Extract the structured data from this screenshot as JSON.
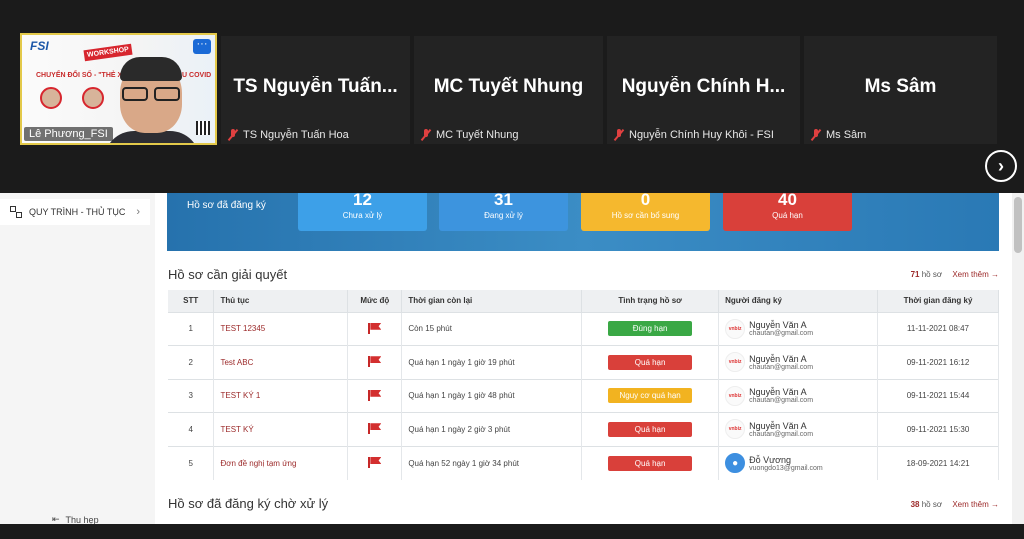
{
  "meeting": {
    "self_tile": {
      "name": "Lê Phương_FSI",
      "slide_logo": "FSI",
      "slide_badge": "WORKSHOP",
      "slide_title": "CHUYỂN ĐỔI SỐ - \"THẺ XANH",
      "slide_title_end": "ẤU COVID",
      "more_label": "···"
    },
    "participants": [
      {
        "display": "TS Nguyễn Tuấn...",
        "label": "TS Nguyễn Tuấn Hoa"
      },
      {
        "display": "MC Tuyết Nhung",
        "label": "MC Tuyết Nhung"
      },
      {
        "display": "Nguyễn Chính H...",
        "label": "Nguyễn Chính Huy Khôi - FSI"
      },
      {
        "display": "Ms Sâm",
        "label": "Ms Sâm"
      }
    ],
    "next_icon": "›"
  },
  "sidebar": {
    "item_label": "QUY TRÌNH - THỦ TỤC",
    "item_chevron": "›",
    "collapse_icon": "⇤",
    "collapse_label": "Thu hẹp"
  },
  "banner": {
    "label": "Hồ sơ đã đăng ký",
    "stats": [
      {
        "value": "12",
        "label": "Chưa xử lý",
        "color": "#3da0e8"
      },
      {
        "value": "31",
        "label": "Đang xử lý",
        "color": "#3d94de"
      },
      {
        "value": "0",
        "label": "Hồ sơ cần bổ sung",
        "color": "#f5b82e"
      },
      {
        "value": "40",
        "label": "Quá hạn",
        "color": "#d9403a"
      }
    ]
  },
  "section1": {
    "title": "Hồ sơ cần giải quyết",
    "count": "71",
    "count_suffix": " hồ sơ",
    "see_more": "Xem thêm →"
  },
  "table": {
    "headers": [
      "STT",
      "Thủ tục",
      "Mức độ",
      "Thời gian còn lại",
      "Tình trạng hồ sơ",
      "Người đăng ký",
      "Thời gian đăng ký"
    ],
    "rows": [
      {
        "stt": "1",
        "proc": "TEST 12345",
        "remaining": "Còn 15 phút",
        "status": "Đúng hạn",
        "status_color": "#3aa845",
        "user": "Nguyễn Văn A",
        "email": "chautan@gmail.com",
        "avatar": "vnbiz",
        "date": "11-11-2021 08:47"
      },
      {
        "stt": "2",
        "proc": "Test ABC",
        "remaining": "Quá hạn 1 ngày 1 giờ 19 phút",
        "status": "Quá hạn",
        "status_color": "#d9403a",
        "user": "Nguyễn Văn A",
        "email": "chautan@gmail.com",
        "avatar": "vnbiz",
        "date": "09-11-2021 16:12"
      },
      {
        "stt": "3",
        "proc": "TEST KÝ 1",
        "remaining": "Quá hạn 1 ngày 1 giờ 48 phút",
        "status": "Nguy cơ quá hạn",
        "status_color": "#f2b320",
        "user": "Nguyễn Văn A",
        "email": "chautan@gmail.com",
        "avatar": "vnbiz",
        "date": "09-11-2021 15:44"
      },
      {
        "stt": "4",
        "proc": "TEST KÝ",
        "remaining": "Quá hạn 1 ngày 2 giờ 3 phút",
        "status": "Quá hạn",
        "status_color": "#d9403a",
        "user": "Nguyễn Văn A",
        "email": "chautan@gmail.com",
        "avatar": "vnbiz",
        "date": "09-11-2021 15:30"
      },
      {
        "stt": "5",
        "proc": "Đơn đề nghị tạm ứng",
        "remaining": "Quá hạn 52 ngày 1 giờ 34 phút",
        "status": "Quá hạn",
        "status_color": "#d9403a",
        "user": "Đỗ Vương",
        "email": "vuongdo13@gmail.com",
        "avatar": "person",
        "date": "18-09-2021 14:21"
      }
    ]
  },
  "section2": {
    "title": "Hồ sơ đã đăng ký chờ xử lý",
    "count": "38",
    "count_suffix": " hồ sơ",
    "see_more": "Xem thêm →"
  }
}
